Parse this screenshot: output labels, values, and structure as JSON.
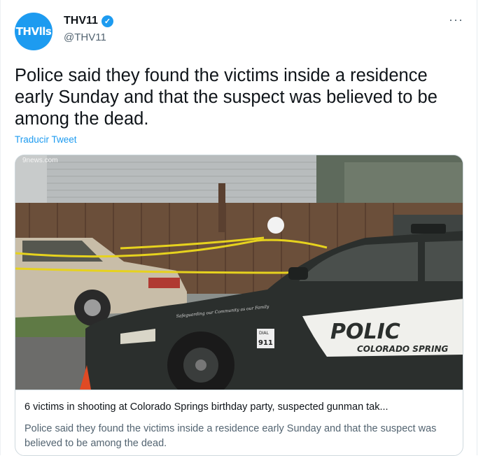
{
  "account": {
    "avatar_text": "THVlls",
    "name": "THV11",
    "handle": "@THV11",
    "verified_glyph": "✓",
    "more_glyph": "···"
  },
  "tweet": {
    "text": "Police said they found the victims inside a residence early Sunday and that the suspect was believed to be among the dead.",
    "translate_label": "Traducir Tweet"
  },
  "card": {
    "image": {
      "watermark": "9news.com",
      "car_text_police": "POLIC",
      "car_text_city": "COLORADO SPRING",
      "car_number": "911",
      "car_dial_label": "DIAL",
      "car_slogan": "Safeguarding our Community as our Family"
    },
    "title": "6 victims in shooting at Colorado Springs birthday party, suspected gunman tak...",
    "description": "Police said they found the victims inside a residence early Sunday and that the suspect was believed to be among the dead."
  },
  "colors": {
    "accent": "#1d9bf0",
    "secondary_text": "#536471",
    "border": "#cfd9de"
  }
}
